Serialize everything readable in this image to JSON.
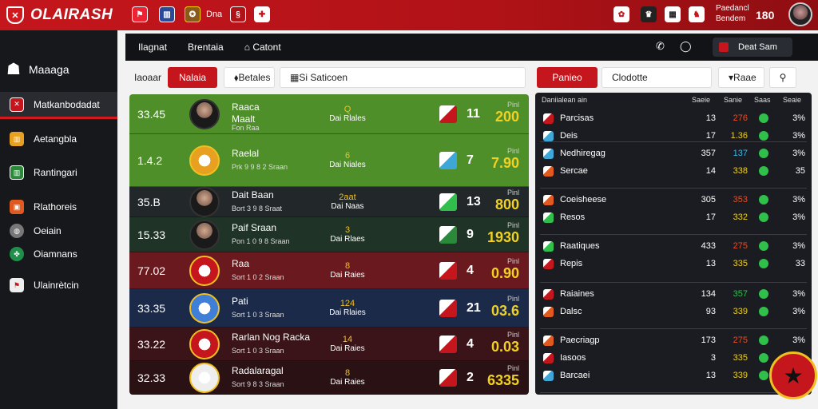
{
  "header": {
    "brand": "OLAIRASH",
    "nav_text": "Dna",
    "right_line1": "Paedancl",
    "right_line2": "Bendem",
    "clock": "180"
  },
  "sidebar": {
    "title": "Maaaga",
    "items": [
      {
        "label": "Matkanbodadat",
        "active": true
      },
      {
        "label": "Aetangbla",
        "active": false
      },
      {
        "label": "Rantingari",
        "active": false
      },
      {
        "label": "Rlathoreis",
        "active": false
      },
      {
        "label": "Oeiain",
        "active": false
      },
      {
        "label": "Oiamnans",
        "active": false
      },
      {
        "label": "Ulainrètcin",
        "active": false
      }
    ]
  },
  "tabs": [
    "Ilagnat",
    "Brentaia",
    "Catont"
  ],
  "tabbar": {
    "profile_label": "Deat Sam"
  },
  "filters": {
    "left_label": "Iaoaar",
    "red_btn": "Nalaia",
    "plain_btn": "Betales",
    "search_value": "Si Saticoen",
    "right_red_btn": "Panieo",
    "right_search": "Clodotte",
    "dropdown": "Raae"
  },
  "matches": [
    {
      "time": "33.45",
      "name1": "Raaca",
      "name2": "Maalt",
      "sub": "Fon Raa",
      "mid_top": "Q",
      "mid_sub": "Dai Rlales",
      "num": "11",
      "odds_lbl": "Pinl",
      "odds": "200",
      "bg": "#4f8f2a",
      "player": true
    },
    {
      "time": "1.4.2",
      "name1": "Raelal",
      "name2": "",
      "sub": "Prk 9 9 8 2 Sraan",
      "mid_top": "6",
      "mid_sub": "Dai Niales",
      "num": "7",
      "odds_lbl": "Pinl",
      "odds": "7.90",
      "bg": "#4f8f2a",
      "player": false
    },
    {
      "time": "35.B",
      "name1": "Dait Baan",
      "name2": "",
      "sub": "Bort 3 9 8 Sraat",
      "mid_top": "2aat",
      "mid_sub": "Dai Naas",
      "num": "13",
      "odds_lbl": "Pinl",
      "odds": "800",
      "bg": "#22282a",
      "player": true
    },
    {
      "time": "15.33",
      "name1": "Paif Sraan",
      "name2": "",
      "sub": "Pon 1 0 9 8 Sraan",
      "mid_top": "3",
      "mid_sub": "Dai Rlaes",
      "num": "9",
      "odds_lbl": "Pinl",
      "odds": "1930",
      "bg": "#1f3326",
      "player": true
    },
    {
      "time": "77.02",
      "name1": "Raa",
      "name2": "",
      "sub": "Sort 1 0 2 Sraan",
      "mid_top": "8",
      "mid_sub": "Dai Raies",
      "num": "4",
      "odds_lbl": "Pinl",
      "odds": "0.90",
      "bg": "#6a1a1e",
      "player": false
    },
    {
      "time": "33.35",
      "name1": "Pati",
      "name2": "",
      "sub": "Sort 1 0 3 Sraan",
      "mid_top": "124",
      "mid_sub": "Dai Rlaies",
      "num": "21",
      "odds_lbl": "Pinl",
      "odds": "03.6",
      "bg": "#1c2a4a",
      "player": false
    },
    {
      "time": "33.22",
      "name1": "Rarlan Nog Racka",
      "name2": "",
      "sub": "Sort 1 0 3 Sraan",
      "mid_top": "14",
      "mid_sub": "Dai Raies",
      "num": "4",
      "odds_lbl": "Pinl",
      "odds": "0.03",
      "bg": "#3a1418",
      "player": false
    },
    {
      "time": "32.33",
      "name1": "Radalaragal",
      "name2": "",
      "sub": "Sort 9 8 3 Sraan",
      "mid_top": "8",
      "mid_sub": "Dai Raies",
      "num": "2",
      "odds_lbl": "Pinl",
      "odds": "6335",
      "bg": "#2a1114",
      "player": false
    }
  ],
  "right_panel": {
    "headers": [
      "Daniialean ain",
      "Saeie",
      "Sanie",
      "Saas",
      "Seaie"
    ],
    "groups": [
      {
        "rows": [
          {
            "label": "Parcisas",
            "c1": "13",
            "c2": "276",
            "c2color": "#e0502a",
            "c4": "3%"
          },
          {
            "label": "Deis",
            "c1": "17",
            "c2": "1.36",
            "c2color": "#f0d020",
            "c4": "3%"
          }
        ]
      },
      {
        "rows": [
          {
            "label": "Nedhiregag",
            "c1": "357",
            "c2": "137",
            "c2color": "#3fb7e8",
            "c4": "3%"
          },
          {
            "label": "Sercae",
            "c1": "14",
            "c2": "338",
            "c2color": "#f0d020",
            "c4": "35"
          }
        ]
      },
      {
        "rows": [
          {
            "label": "Coeisheese",
            "c1": "305",
            "c2": "353",
            "c2color": "#e0502a",
            "c4": "3%"
          },
          {
            "label": "Resos",
            "c1": "17",
            "c2": "332",
            "c2color": "#f0d020",
            "c4": "3%"
          }
        ]
      },
      {
        "rows": [
          {
            "label": "Raatiques",
            "c1": "433",
            "c2": "275",
            "c2color": "#e0502a",
            "c4": "3%"
          },
          {
            "label": "Repis",
            "c1": "13",
            "c2": "335",
            "c2color": "#f0d020",
            "c4": "33"
          }
        ]
      },
      {
        "rows": [
          {
            "label": "Raiaines",
            "c1": "134",
            "c2": "357",
            "c2color": "#2fbf4a",
            "c4": "3%"
          },
          {
            "label": "Dalsc",
            "c1": "93",
            "c2": "339",
            "c2color": "#f0d020",
            "c4": "3%"
          }
        ]
      },
      {
        "rows": [
          {
            "label": "Paecriagp",
            "c1": "173",
            "c2": "275",
            "c2color": "#e0502a",
            "c4": "3%"
          },
          {
            "label": "Iasoos",
            "c1": "3",
            "c2": "335",
            "c2color": "#f0d020",
            "c4": "33"
          },
          {
            "label": "Barcaei",
            "c1": "13",
            "c2": "339",
            "c2color": "#f0d020",
            "c4": ""
          }
        ]
      }
    ]
  }
}
